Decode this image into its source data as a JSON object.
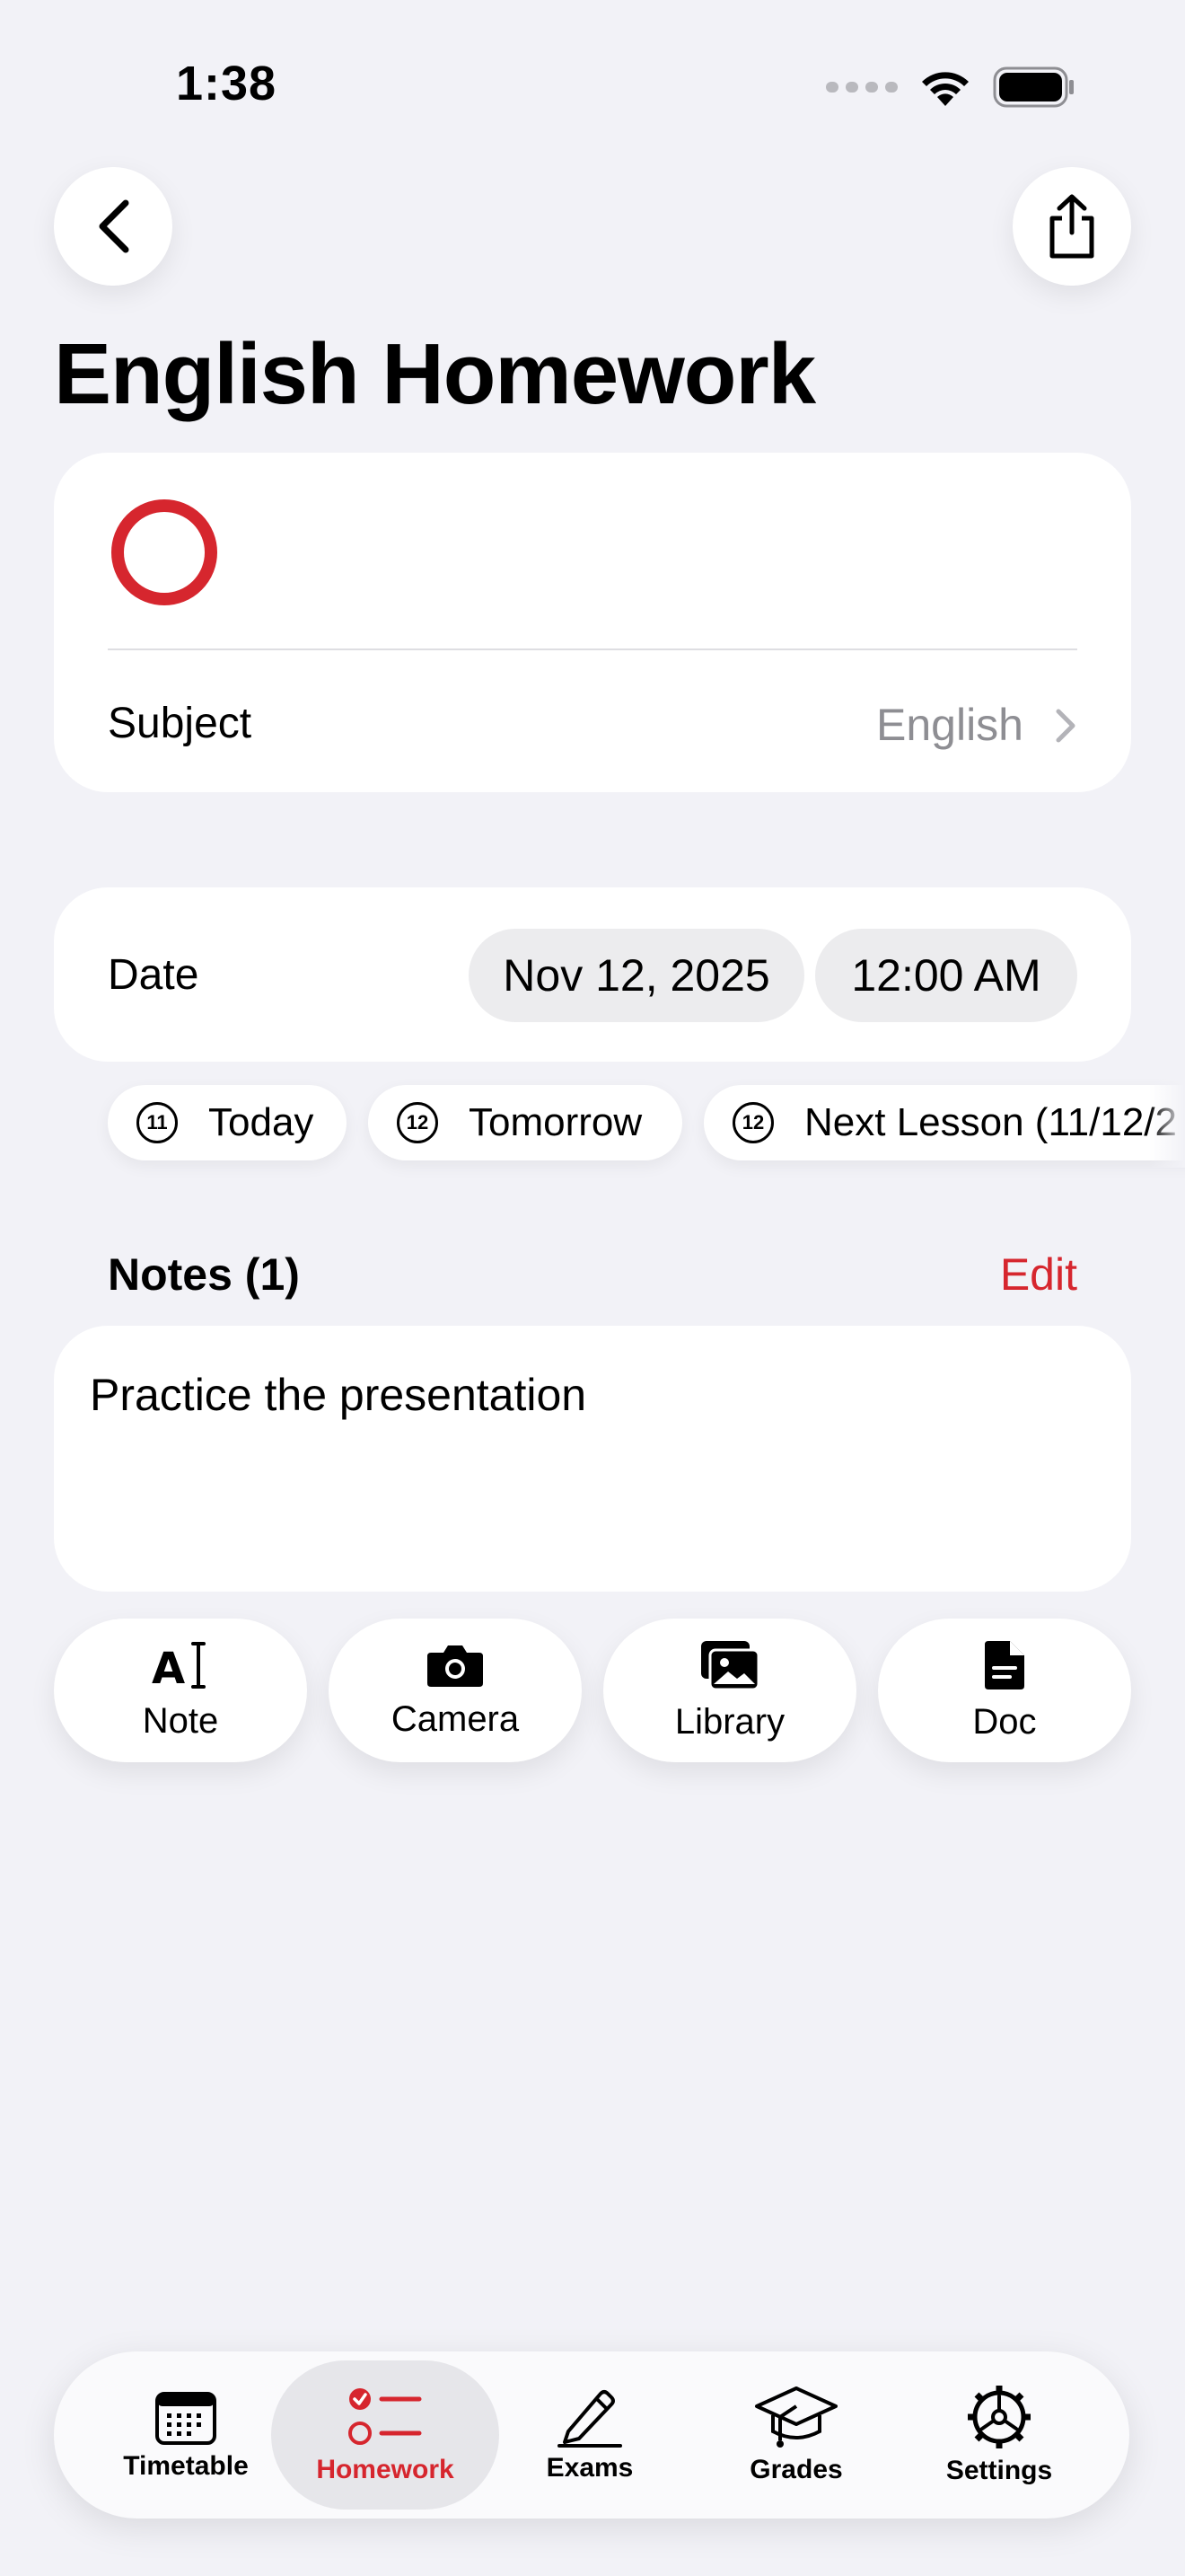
{
  "status_bar": {
    "time": "1:38"
  },
  "header": {
    "title": "English Homework"
  },
  "main_card": {
    "subject_label": "Subject",
    "subject_value": "English"
  },
  "date_card": {
    "label": "Date",
    "date": "Nov 12, 2025",
    "time": "12:00 AM"
  },
  "quick_dates": [
    {
      "day": "11",
      "label": "Today"
    },
    {
      "day": "12",
      "label": "Tomorrow"
    },
    {
      "day": "12",
      "label": "Next Lesson (11/12/2"
    }
  ],
  "notes": {
    "header": "Notes (1)",
    "edit_label": "Edit",
    "items": [
      "Practice the presentation"
    ]
  },
  "attachments": [
    {
      "label": "Note"
    },
    {
      "label": "Camera"
    },
    {
      "label": "Library"
    },
    {
      "label": "Doc"
    }
  ],
  "tab_bar": {
    "active": "Homework",
    "items": [
      {
        "label": "Timetable"
      },
      {
        "label": "Homework"
      },
      {
        "label": "Exams"
      },
      {
        "label": "Grades"
      },
      {
        "label": "Settings"
      }
    ]
  },
  "colors": {
    "accent": "#d6262e",
    "background": "#f2f2f7",
    "card": "#ffffff"
  }
}
